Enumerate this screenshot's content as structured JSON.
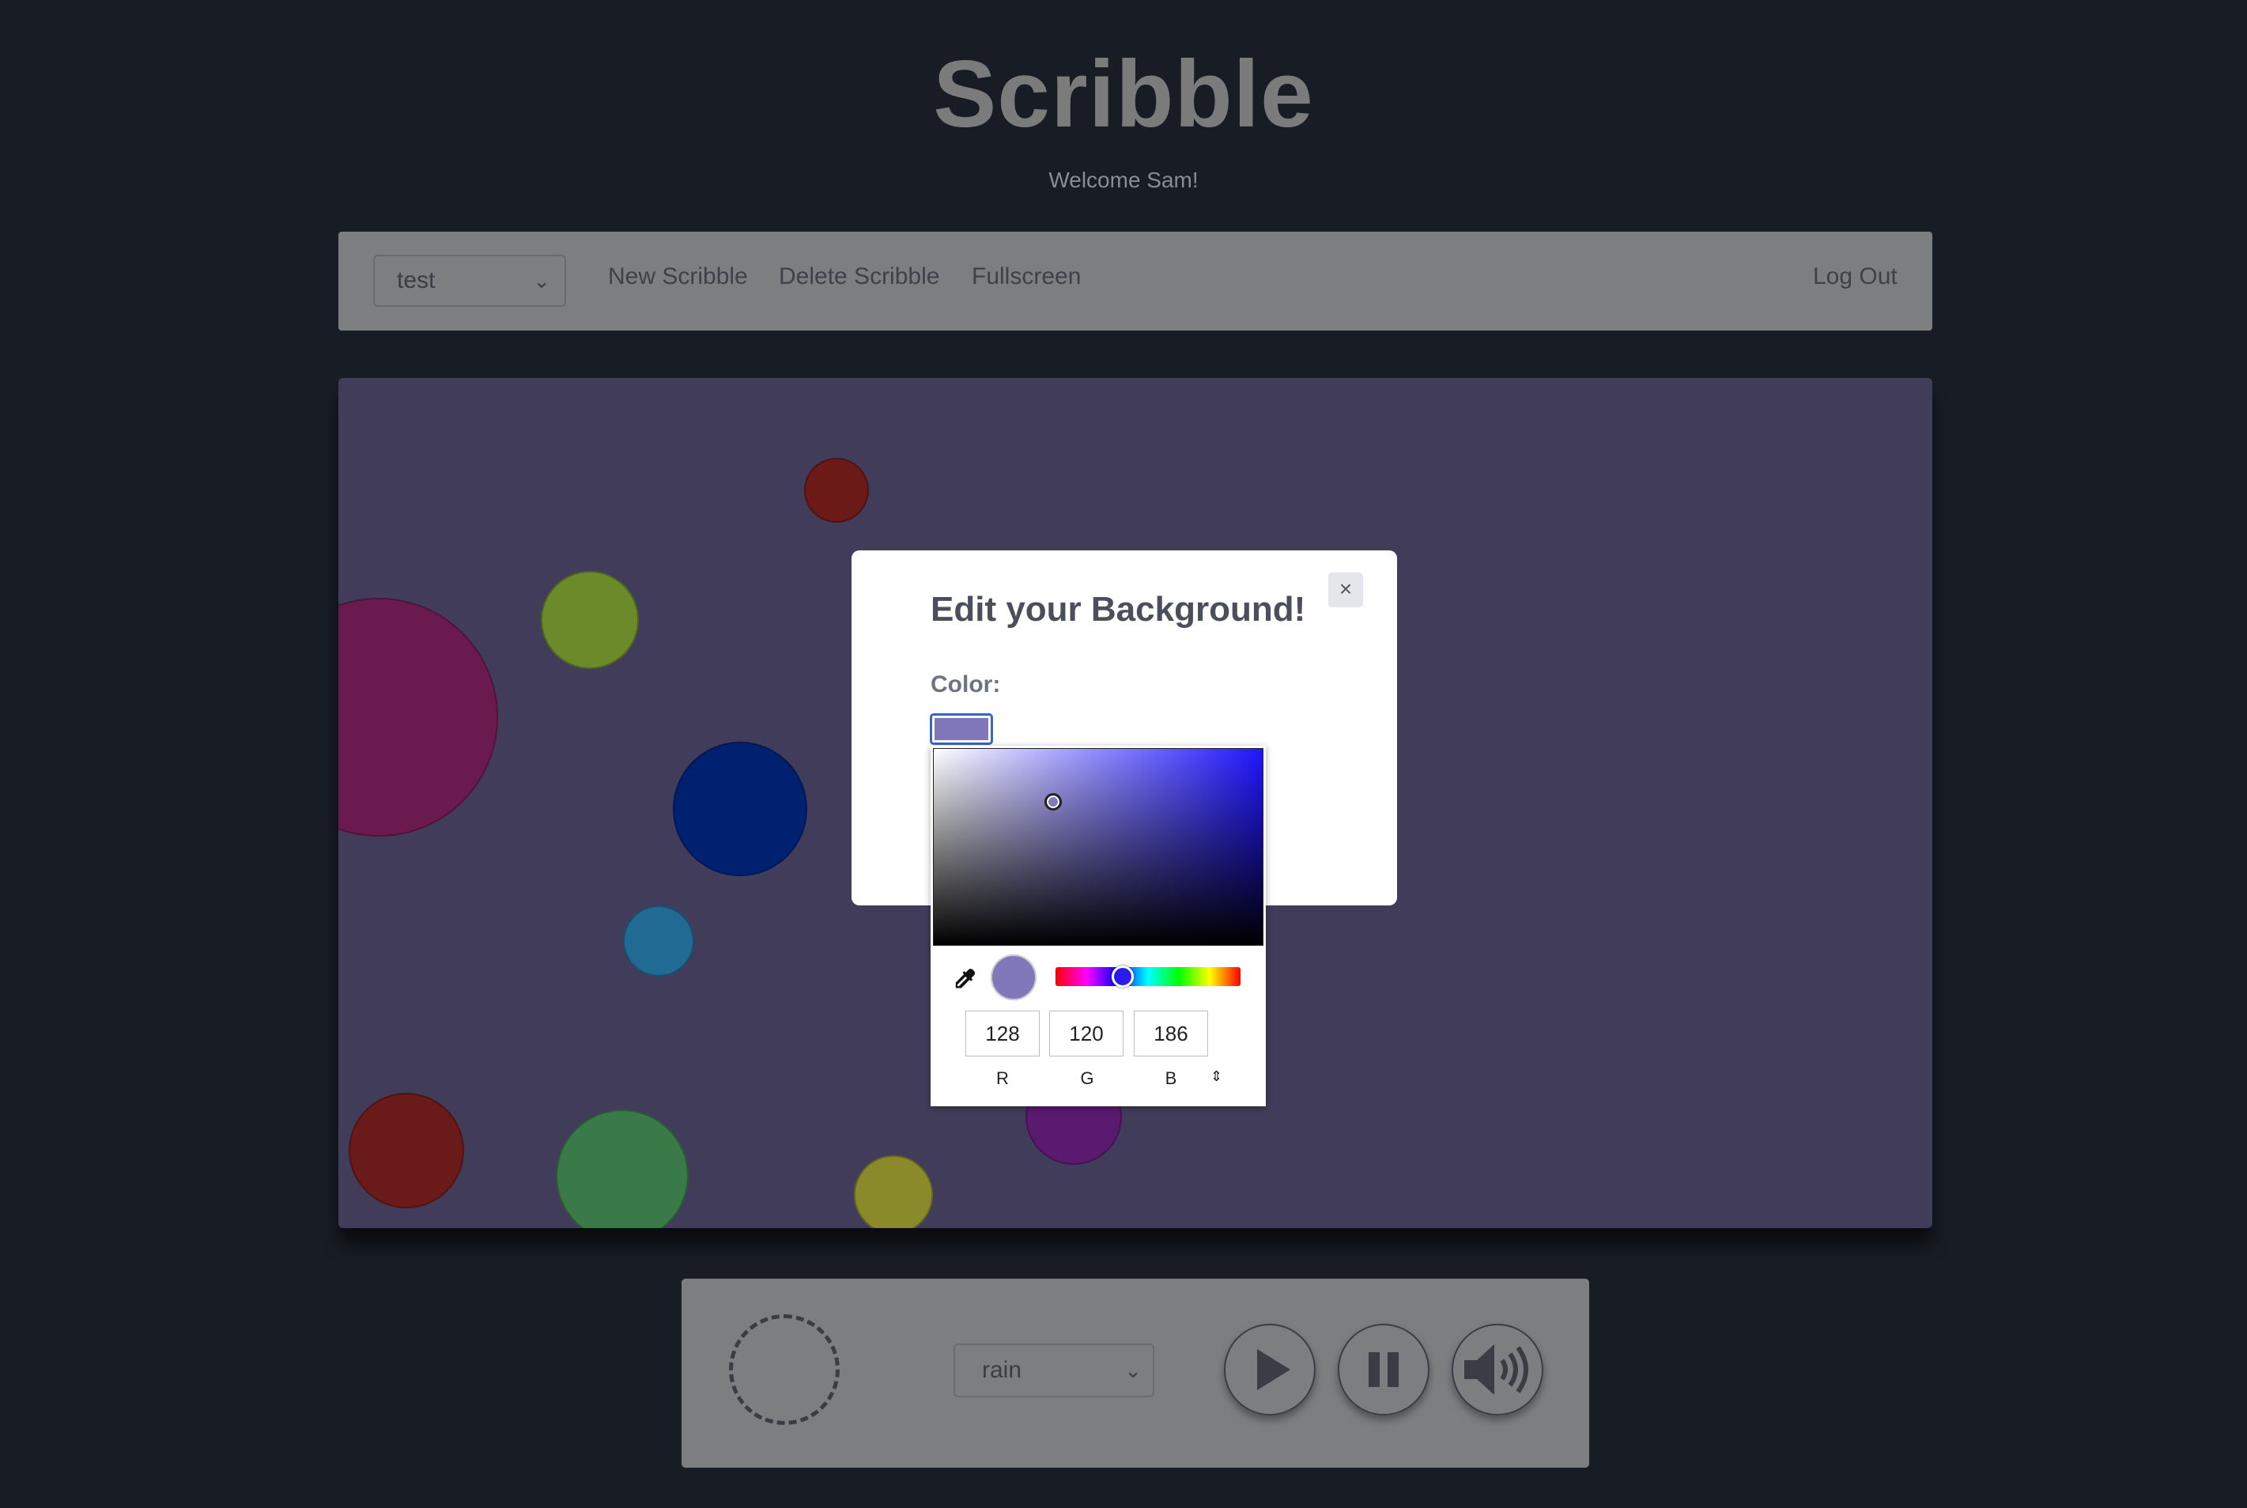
{
  "header": {
    "title": "Scribble",
    "welcome": "Welcome Sam!"
  },
  "nav": {
    "selected_scribble": "test",
    "links": [
      "New Scribble",
      "Delete Scribble",
      "Fullscreen"
    ],
    "logout": "Log Out"
  },
  "canvas": {
    "background_color": "#403c5a",
    "circle_colors": [
      "#6b1a50",
      "#6b8a2a",
      "#6b1a18",
      "#002070",
      "#206a94",
      "#6a1a18",
      "#3a7a48",
      "#8a8a2a",
      "#5a1a70"
    ]
  },
  "modal": {
    "title": "Edit your Background!",
    "close_label": "×",
    "color_label": "Color:",
    "current_color": "#8078ba"
  },
  "color_picker": {
    "r": "128",
    "g": "120",
    "b": "186",
    "labels": [
      "R",
      "G",
      "B"
    ],
    "mode_toggle": "⇕"
  },
  "player": {
    "sound": "rain",
    "buttons": [
      "play-icon",
      "pause-icon",
      "volume-icon"
    ]
  }
}
